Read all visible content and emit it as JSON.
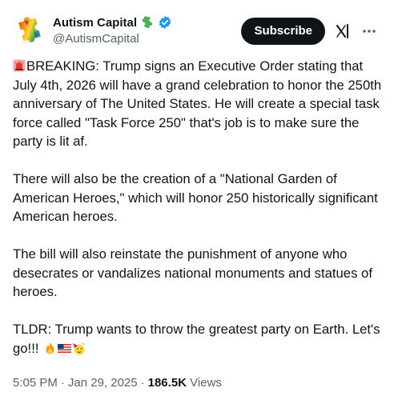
{
  "author": {
    "display_name": "Autism Capital",
    "handle": "@AutismCapital",
    "avatar_icon": "puzzle-piece-rainbow-icon",
    "name_badge_icon": "puzzle-piece-green-icon",
    "verified_icon": "verified-badge-icon",
    "verified_color": "#1d9bf0"
  },
  "actions": {
    "subscribe_label": "Subscribe",
    "grok_icon": "grok-icon",
    "more_icon": "more-options-icon"
  },
  "tweet": {
    "paragraphs": [
      "BREAKING: Trump signs an Executive Order stating that July 4th, 2026 will have a grand celebration to honor the 250th anniversary of The United States. He will create a special task force called \"Task Force 250\" that's job is to make sure the party is lit af.",
      "There will also be the creation of a \"National Garden of American Heroes,\" which will honor 250 historically significant American heroes.",
      "The bill will also reinstate the punishment of anyone who desecrates or vandalizes national monuments and statues of heroes.",
      "TLDR: Trump wants to throw the greatest party on Earth. Let's go!!! "
    ],
    "leading_emoji": "rotating-light-icon",
    "trailing_emojis": [
      "fire-icon",
      "us-flag-icon",
      "partying-face-icon"
    ]
  },
  "meta": {
    "time": "5:05 PM",
    "date": "Jan 29, 2025",
    "separator": "·",
    "views_count": "186.5K",
    "views_label": "Views"
  },
  "colors": {
    "text": "#0f1419",
    "secondary_text": "#536471",
    "subscribe_bg": "#0f1419"
  }
}
